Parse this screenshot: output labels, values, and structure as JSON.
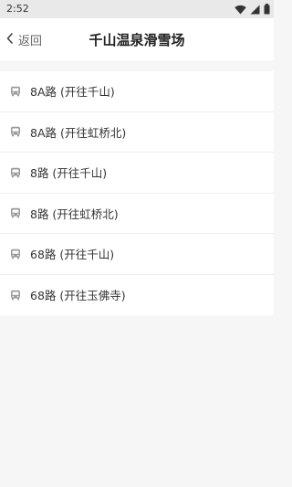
{
  "status_bar": {
    "time": "2:52",
    "icons": [
      "wifi-icon",
      "signal-icon",
      "battery-icon"
    ]
  },
  "header": {
    "back_label": "返回",
    "title": "千山温泉滑雪场"
  },
  "routes": [
    {
      "label": "8A路 (开往千山)",
      "icon": "bus-icon"
    },
    {
      "label": "8A路 (开往虹桥北)",
      "icon": "bus-icon"
    },
    {
      "label": "8路 (开往千山)",
      "icon": "bus-icon"
    },
    {
      "label": "8路 (开往虹桥北)",
      "icon": "bus-icon"
    },
    {
      "label": "68路 (开往千山)",
      "icon": "bus-icon"
    },
    {
      "label": "68路 (开往玉佛寺)",
      "icon": "bus-icon"
    }
  ],
  "colors": {
    "status_bar_bg": "#e9e9e9",
    "page_bg": "#f6f6f6",
    "surface": "#ffffff",
    "icon_gray": "#9a9a9a"
  }
}
